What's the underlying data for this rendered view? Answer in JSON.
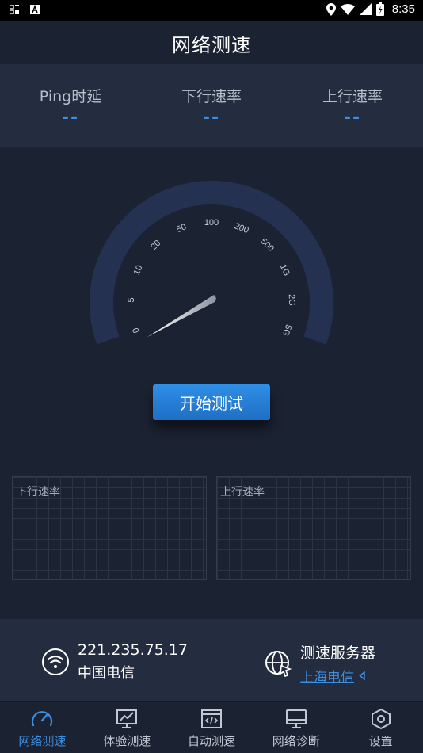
{
  "status_bar": {
    "time": "8:35"
  },
  "app": {
    "title": "网络测速"
  },
  "stats": [
    {
      "label": "Ping时延",
      "value": "--"
    },
    {
      "label": "下行速率",
      "value": "--"
    },
    {
      "label": "上行速率",
      "value": "--"
    }
  ],
  "gauge": {
    "ticks": [
      "0",
      "5",
      "10",
      "20",
      "50",
      "100",
      "200",
      "500",
      "1G",
      "2G",
      "5G"
    ],
    "current_value": 0
  },
  "start_button": {
    "label": "开始测试"
  },
  "charts": {
    "download_label": "下行速率",
    "upload_label": "上行速率"
  },
  "network": {
    "ip": "221.235.75.17",
    "carrier": "中国电信",
    "server_title": "测速服务器",
    "server_name": "上海电信"
  },
  "tabs": [
    {
      "label": "网络测速",
      "icon": "speedometer-icon",
      "active": true
    },
    {
      "label": "体验测速",
      "icon": "chart-monitor-icon",
      "active": false
    },
    {
      "label": "自动测速",
      "icon": "code-window-icon",
      "active": false
    },
    {
      "label": "网络诊断",
      "icon": "monitor-icon",
      "active": false
    },
    {
      "label": "设置",
      "icon": "settings-hexagon-icon",
      "active": false
    }
  ],
  "colors": {
    "background": "#1b2232",
    "panel": "#242d3f",
    "accent": "#3c8fe0",
    "gauge_arc": "#243150"
  }
}
